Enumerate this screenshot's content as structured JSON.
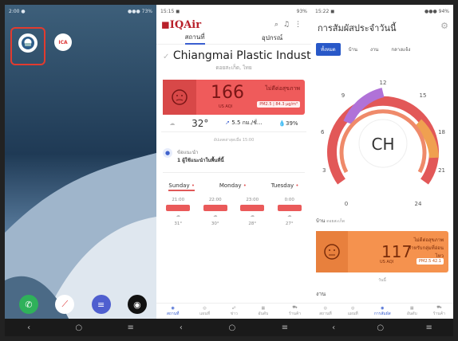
{
  "screen1": {
    "status": {
      "left": "2:00 ●",
      "right": "●●● 73%"
    },
    "app_label": "ICA",
    "nav": [
      "‹",
      "○",
      "≡"
    ]
  },
  "screen2": {
    "status": {
      "left": "15:15 ◼",
      "right": "93%"
    },
    "logo": "IQAir",
    "tabs": [
      "สถานที่",
      "อุปกรณ์"
    ],
    "location": "Chiangmai Plastic Indust...",
    "location_sub": "ดอยสะเก็ด, ไทย",
    "aqi": {
      "value": "166",
      "unit": "US AQI",
      "status": "ไม่ดีต่อสุขภาพ",
      "pm": "PM2.5 | 84.3 µg/m³"
    },
    "weather": {
      "temp": "32°",
      "wind": "5.5 กม./ชั่...",
      "humidity": "39%"
    },
    "updated": "อัปเดตล่าสุดเมื่อ 15:00",
    "rec_title": "ข้อแนะนำ",
    "rec_text": "1 ผู้ใช้แนะนำในพื้นที่นี้",
    "days": [
      "Sunday",
      "Monday",
      "Tuesday"
    ],
    "forecast": [
      {
        "time": "21:00",
        "temp": "31°",
        "wind": "4"
      },
      {
        "time": "22:00",
        "temp": "30°",
        "wind": "4"
      },
      {
        "time": "23:00",
        "temp": "28°",
        "wind": "4"
      },
      {
        "time": "0:00",
        "temp": "27°",
        "wind": "4"
      }
    ],
    "bottom_nav": [
      "สถานที่",
      "แผนที่",
      "ข่าว",
      "อันดับ",
      "ร้านค้า"
    ],
    "nav": [
      "‹",
      "○",
      "≡"
    ]
  },
  "screen3": {
    "status": {
      "left": "15:22 ◼",
      "right": "●●● 94%"
    },
    "title": "การสัมผัสประจำวันนี้",
    "chips": [
      "ทั้งหมด",
      "บ้าน",
      "งาน",
      "กลางแจ้ง"
    ],
    "clock_center": "CH",
    "clock_labels": [
      "12",
      "15",
      "18",
      "21",
      "24",
      "0",
      "3",
      "6",
      "9"
    ],
    "home_label": "บ้าน",
    "home_sub": "ดอยสะเก็ด",
    "card": {
      "value": "117",
      "unit": "US AQI",
      "status": "ไม่ดีต่อสุขภาพสำหรับกลุ่มที่อ่อนไหว",
      "pm": "PM2.5 42.1"
    },
    "card_sub": "วันนี้",
    "work_label": "งาน",
    "bottom_nav": [
      "สถานที่",
      "แผนที่",
      "การสัมผัส",
      "อันดับ",
      "ร้านค้า"
    ],
    "nav": [
      "‹",
      "○",
      "≡"
    ]
  },
  "colors": {
    "unhealthy": "#ef5b5b",
    "sensitive": "#f5924e",
    "accent": "#2858c8",
    "highlight": "#e23b2f"
  }
}
